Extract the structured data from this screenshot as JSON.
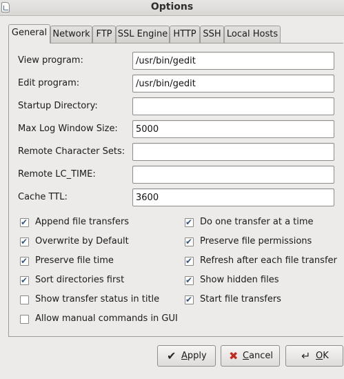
{
  "window": {
    "title": "Options"
  },
  "tabs": [
    {
      "label": "General",
      "active": true
    },
    {
      "label": "Network"
    },
    {
      "label": "FTP"
    },
    {
      "label": "SSL Engine"
    },
    {
      "label": "HTTP"
    },
    {
      "label": "SSH"
    },
    {
      "label": "Local Hosts"
    }
  ],
  "fields": [
    {
      "label": "View program:",
      "value": "/usr/bin/gedit"
    },
    {
      "label": "Edit program:",
      "value": "/usr/bin/gedit"
    },
    {
      "label": "Startup Directory:",
      "value": ""
    },
    {
      "label": "Max Log Window Size:",
      "value": "5000"
    },
    {
      "label": "Remote Character Sets:",
      "value": ""
    },
    {
      "label": "Remote LC_TIME:",
      "value": ""
    },
    {
      "label": "Cache TTL:",
      "value": "3600"
    }
  ],
  "checkboxes": [
    {
      "label": "Append file transfers",
      "checked": true
    },
    {
      "label": "Do one transfer at a time",
      "checked": true
    },
    {
      "label": "Overwrite by Default",
      "checked": true
    },
    {
      "label": "Preserve file permissions",
      "checked": true
    },
    {
      "label": "Preserve file time",
      "checked": true
    },
    {
      "label": "Refresh after each file transfer",
      "checked": true
    },
    {
      "label": "Sort directories first",
      "checked": true
    },
    {
      "label": "Show hidden files",
      "checked": true
    },
    {
      "label": "Show transfer status in title",
      "checked": false
    },
    {
      "label": "Start file transfers",
      "checked": true
    },
    {
      "label": "Allow manual commands in GUI",
      "checked": false
    }
  ],
  "buttons": {
    "apply": {
      "mnemonic": "A",
      "rest": "pply",
      "icon": "checkmark-icon"
    },
    "cancel": {
      "mnemonic": "C",
      "rest": "ancel",
      "icon": "red-x-icon"
    },
    "ok": {
      "mnemonic": "O",
      "rest": "K",
      "icon": "return-arrow-icon"
    }
  },
  "colors": {
    "check": "#2f5287",
    "cancel_x": "#c22a1f",
    "apply_check": "#2a2a2a"
  }
}
